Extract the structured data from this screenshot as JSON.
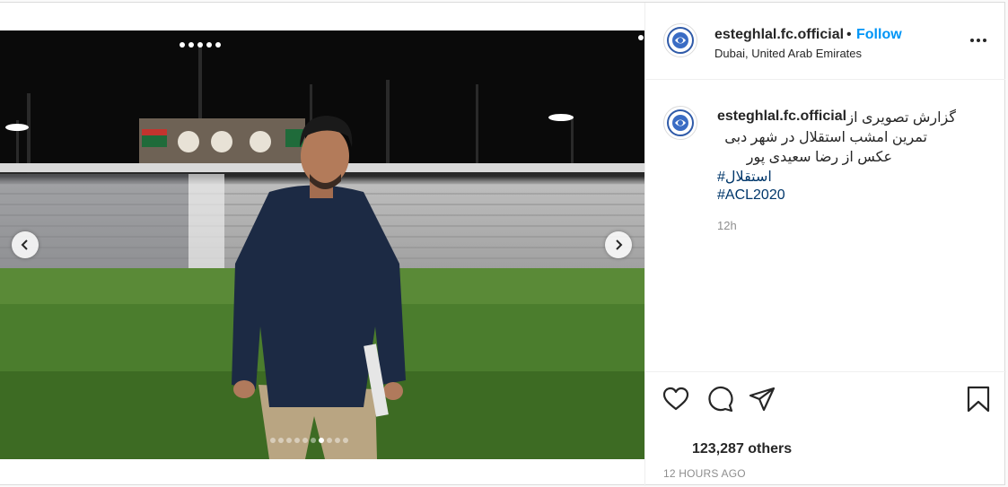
{
  "post": {
    "username": "esteghlal.fc.official",
    "follow_label": "Follow",
    "separator": "•",
    "location": "Dubai, United Arab Emirates"
  },
  "caption": {
    "username": "esteghlal.fc.official",
    "line1": "گزارش تصویری از",
    "line2": "تمرین امشب استقلال در شهر دبی",
    "line3": "عکس از رضا سعیدی پور",
    "hashtag1": "#استقلال",
    "hashtag2": "#ACL2020",
    "relative_time": "12h"
  },
  "engagement": {
    "likes": "123,287 others",
    "timestamp": "12 HOURS AGO"
  },
  "carousel": {
    "total": 10,
    "active_index": 7
  },
  "icons": {
    "like": "heart-icon",
    "comment": "comment-bubble-icon",
    "share": "paper-plane-icon",
    "save": "bookmark-icon",
    "more": "more-options-icon",
    "prev": "chevron-left-icon",
    "next": "chevron-right-icon"
  },
  "colors": {
    "follow": "#0095f6",
    "hashtag": "#00376b",
    "muted": "#8e8e8e",
    "text": "#262626"
  }
}
